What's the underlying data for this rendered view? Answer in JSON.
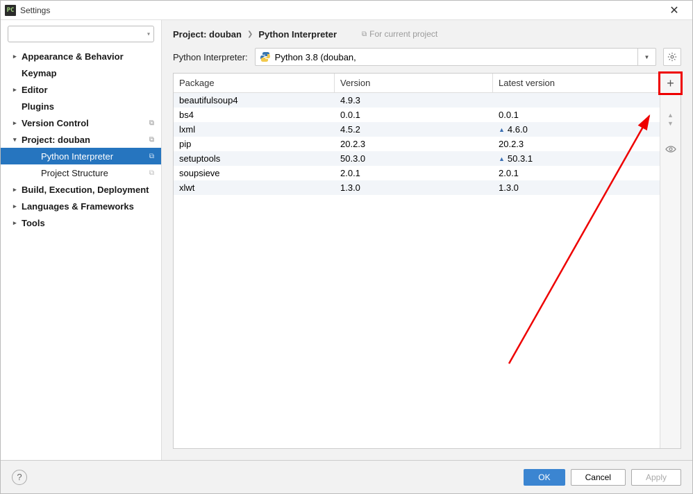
{
  "window": {
    "title": "Settings",
    "app_icon_text": "PC"
  },
  "search": {
    "placeholder": ""
  },
  "sidebar": {
    "items": [
      {
        "label": "Appearance & Behavior",
        "arrow": "›",
        "bold": true,
        "level": 1
      },
      {
        "label": "Keymap",
        "arrow": "",
        "bold": true,
        "level": 1
      },
      {
        "label": "Editor",
        "arrow": "›",
        "bold": true,
        "level": 1
      },
      {
        "label": "Plugins",
        "arrow": "",
        "bold": true,
        "level": 1
      },
      {
        "label": "Version Control",
        "arrow": "›",
        "bold": true,
        "level": 1,
        "copy": true
      },
      {
        "label": "Project: douban",
        "arrow": "⌄",
        "bold": true,
        "level": 1,
        "copy": true
      },
      {
        "label": "Python Interpreter",
        "arrow": "",
        "bold": false,
        "level": 2,
        "selected": true,
        "copy": true
      },
      {
        "label": "Project Structure",
        "arrow": "",
        "bold": false,
        "level": 2,
        "copy": true
      },
      {
        "label": "Build, Execution, Deployment",
        "arrow": "›",
        "bold": true,
        "level": 1
      },
      {
        "label": "Languages & Frameworks",
        "arrow": "›",
        "bold": true,
        "level": 1
      },
      {
        "label": "Tools",
        "arrow": "›",
        "bold": true,
        "level": 1
      }
    ]
  },
  "breadcrumb": {
    "crumb1": "Project: douban",
    "crumb2": "Python Interpreter",
    "hint": "For current project"
  },
  "interpreter": {
    "label": "Python Interpreter:",
    "value": "Python 3.8 (douban,"
  },
  "columns": {
    "pkg": "Package",
    "ver": "Version",
    "lat": "Latest version"
  },
  "packages": [
    {
      "name": "beautifulsoup4",
      "version": "4.9.3",
      "latest": "",
      "upgrade": false
    },
    {
      "name": "bs4",
      "version": "0.0.1",
      "latest": "0.0.1",
      "upgrade": false
    },
    {
      "name": "lxml",
      "version": "4.5.2",
      "latest": "4.6.0",
      "upgrade": true
    },
    {
      "name": "pip",
      "version": "20.2.3",
      "latest": "20.2.3",
      "upgrade": false
    },
    {
      "name": "setuptools",
      "version": "50.3.0",
      "latest": "50.3.1",
      "upgrade": true
    },
    {
      "name": "soupsieve",
      "version": "2.0.1",
      "latest": "2.0.1",
      "upgrade": false
    },
    {
      "name": "xlwt",
      "version": "1.3.0",
      "latest": "1.3.0",
      "upgrade": false
    }
  ],
  "buttons": {
    "ok": "OK",
    "cancel": "Cancel",
    "apply": "Apply"
  }
}
